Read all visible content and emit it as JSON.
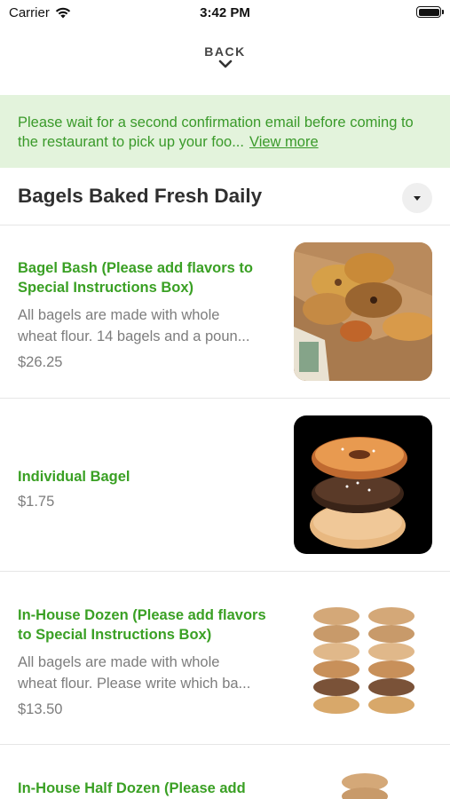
{
  "status_bar": {
    "carrier": "Carrier",
    "time": "3:42 PM"
  },
  "nav": {
    "back_label": "BACK"
  },
  "notice": {
    "text": "Please wait for a second confirmation email before coming to the restaurant to pick up your foo...",
    "link_label": "View more"
  },
  "section": {
    "title": "Bagels Baked Fresh Daily"
  },
  "items": [
    {
      "name": "Bagel Bash  (Please add flavors to Special Instructions Box)",
      "description_line1": "All bagels are made with whole",
      "description_line2": "wheat flour. 14 bagels and a poun...",
      "price": "$26.25",
      "image": "bagel-box-image"
    },
    {
      "name": "Individual Bagel",
      "price": "$1.75",
      "image": "bagel-stack-image"
    },
    {
      "name": "In-House Dozen (Please add flavors to Special Instructions Box)",
      "description_line1": "All bagels are made with whole",
      "description_line2": "wheat flour. Please write which ba...",
      "price": "$13.50",
      "image": "bagel-dozen-image"
    },
    {
      "name": "In-House Half Dozen (Please add",
      "image": "bagel-half-dozen-image"
    }
  ],
  "colors": {
    "accent_green": "#3aa024",
    "notice_bg": "#e3f3dc",
    "notice_text": "#3a9a2a"
  }
}
